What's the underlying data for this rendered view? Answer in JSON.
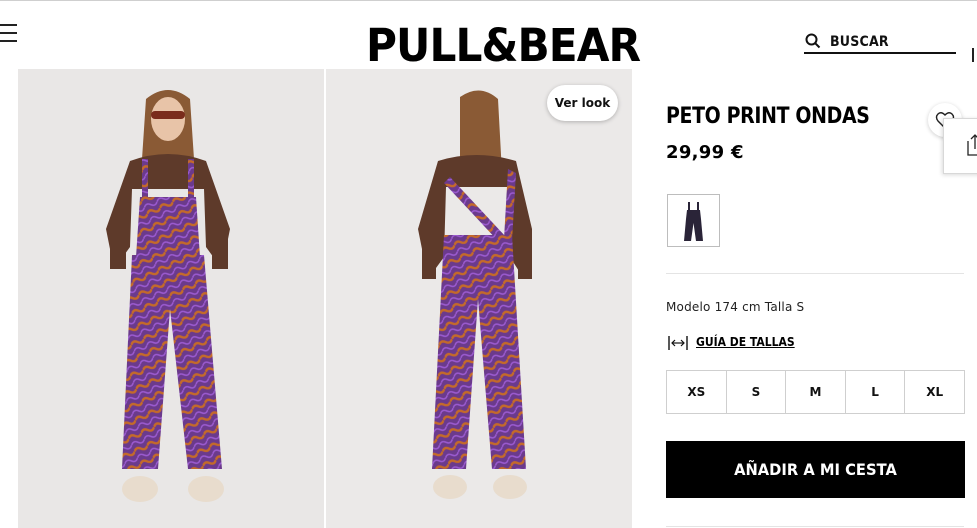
{
  "header": {
    "brand": "PULL&BEAR",
    "search_label": "BUSCAR",
    "menu_icon": "hamburger-icon",
    "search_icon": "search-icon"
  },
  "gallery": {
    "ver_look_label": "Ver look",
    "images": [
      {
        "view": "front",
        "alt": "front"
      },
      {
        "view": "back",
        "alt": "back"
      }
    ]
  },
  "product": {
    "name": "PETO PRINT ONDAS",
    "price": "29,99 €",
    "favorite_icon": "heart-icon",
    "share_icon": "share-icon",
    "model_info": "Modelo 174 cm Talla S",
    "size_guide_label": "GUÍA DE TALLAS",
    "size_guide_icon": "ruler-icon",
    "sizes": [
      "XS",
      "S",
      "M",
      "L",
      "XL"
    ],
    "add_to_cart_label": "AÑADIR A MI CESTA"
  },
  "colors": {
    "accent": "#000000",
    "print_purple": "#6b3a8c",
    "print_orange": "#c46a2a",
    "sweater_brown": "#5e3a2a"
  }
}
